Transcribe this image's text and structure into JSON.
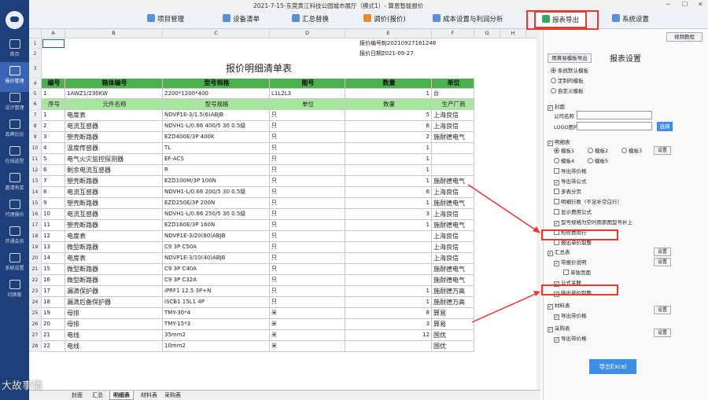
{
  "window": {
    "title": "2021-7-15-东莞黄江科技公园城市展厅（模式1）- 算恩智能报价"
  },
  "sidebar": {
    "items": [
      {
        "label": "首页"
      },
      {
        "label": "报价管理"
      },
      {
        "label": "设计管理"
      },
      {
        "label": "品牌比价"
      },
      {
        "label": "在线选型"
      },
      {
        "label": "邀请有奖"
      },
      {
        "label": "代理报价"
      },
      {
        "label": "开通会员"
      },
      {
        "label": "系统设置"
      },
      {
        "label": "切换版"
      }
    ]
  },
  "toolbar": {
    "items": [
      {
        "label": "项目管理",
        "color": "#5b8fd9"
      },
      {
        "label": "设备清单",
        "color": "#5b8fd9"
      },
      {
        "label": "汇总替换",
        "color": "#5b8fd9"
      },
      {
        "label": "调价(报价)",
        "color": "#e58a2b"
      },
      {
        "label": "成本设置与利润分析",
        "color": "#5b8fd9"
      },
      {
        "label": "报表导出",
        "color": "#3aa564"
      },
      {
        "label": "系统设置",
        "color": "#5b8fd9"
      }
    ]
  },
  "sheet": {
    "columns": [
      "A",
      "B",
      "C",
      "D",
      "E",
      "F",
      "G",
      "H",
      "I"
    ],
    "row_numbers": [
      "1",
      "2",
      "3",
      "4",
      "5",
      "6",
      "7",
      "8",
      "9",
      "10",
      "11",
      "12",
      "13",
      "14",
      "15",
      "16",
      "17",
      "18",
      "19",
      "20",
      "21",
      "22",
      "23",
      "24",
      "25",
      "26",
      "27",
      "28"
    ],
    "quote_no_label": "报价编号：",
    "quote_no": "BJ20210927161248",
    "quote_date_label": "报价日期：",
    "quote_date": "2021-09-27",
    "title": "报价明细清单表",
    "box_header": [
      "编号",
      "箱体编号",
      "型号规格",
      "图号",
      "数量",
      "单位"
    ],
    "box_row": [
      "1",
      "1AWZ1/230KW",
      "2200*1200*400",
      "L1L2L3",
      "1",
      "台"
    ],
    "item_header": [
      "序号",
      "元件名称",
      "型号规格",
      "单位",
      "数量",
      "生产厂商"
    ],
    "items": [
      [
        "1",
        "电度表",
        "NDVP1E-3/1.5(6)ABJB",
        "只",
        "5",
        "上海良信"
      ],
      [
        "2",
        "电流互感器",
        "NDVH1-L/0.66 400/5 30 0.5级",
        "只",
        "6",
        "上海良信"
      ],
      [
        "3",
        "塑壳断路器",
        "EZD400E/3P 400K",
        "只",
        "2",
        "施耐德电气"
      ],
      [
        "4",
        "温度传感器",
        "TL",
        "只",
        "1",
        ""
      ],
      [
        "5",
        "电气火灾监控探测器",
        "EF-ACS",
        "只",
        "1",
        ""
      ],
      [
        "6",
        "剩余电流互感器",
        "R",
        "只",
        "1",
        ""
      ],
      [
        "7",
        "塑壳断路器",
        "EZD100M/3P 100N",
        "只",
        "1",
        "施耐德电气"
      ],
      [
        "8",
        "电流互感器",
        "NDVH1-L/0.66 200/5 30 0.5级",
        "只",
        "6",
        "上海良信"
      ],
      [
        "9",
        "塑壳断路器",
        "EZD250E/3P 200N",
        "只",
        "1",
        "施耐德电气"
      ],
      [
        "10",
        "电流互感器",
        "NDVH1-L/0.66 250/5 30 0.5级",
        "只",
        "3",
        "上海良信"
      ],
      [
        "11",
        "塑壳断路器",
        "EZD160E/3P 160N",
        "只",
        "1",
        "施耐德电气"
      ],
      [
        "12",
        "电度表",
        "NDVP1E-3/20(80)ABJB",
        "只",
        "",
        "上海良信"
      ],
      [
        "13",
        "微型断路器",
        "C9 3P C50A",
        "只",
        "",
        "上海良信"
      ],
      [
        "14",
        "电度表",
        "NDVP1E-3/10(40)ABJB",
        "只",
        "",
        "上海良信"
      ],
      [
        "15",
        "微型断路器",
        "C9 3P C40A",
        "只",
        "",
        "施耐德电气"
      ],
      [
        "16",
        "微型断路器",
        "C9 3P C32A",
        "只",
        "",
        "施耐德电气"
      ],
      [
        "17",
        "漏滴保护器",
        "iPRF1 12.5 3P+N",
        "只",
        "1",
        "施耐德万高"
      ],
      [
        "18",
        "漏滴后备保护器",
        "iSCB1 15L1 4P",
        "只",
        "1",
        "施耐德万高"
      ],
      [
        "19",
        "母排",
        "TMY-30*4",
        "米",
        "8",
        "算易"
      ],
      [
        "20",
        "母排",
        "TMY-15*3",
        "米",
        "3",
        "算易"
      ],
      [
        "21",
        "电线",
        "35mm2",
        "米",
        "12",
        "国优"
      ],
      [
        "22",
        "电线",
        "10mm2",
        "米",
        "",
        "国优"
      ]
    ]
  },
  "sheet_tabs": [
    "封面",
    "汇总",
    "明细表",
    "材料表",
    "采购表"
  ],
  "watermark": "大故事情",
  "panel": {
    "tutorial_btn": "视频教程",
    "template_btn": "用算易模板导出",
    "title": "报表设置",
    "template_options": [
      "系统默认模板",
      "定制的模板",
      "自定义模板"
    ],
    "cover_label": "封面",
    "company_label": "公司名称",
    "logo_label": "LOGO图片",
    "select_btn": "选择",
    "detail_label": "明细表",
    "detail_templates": [
      "模板1",
      "模板2",
      "模板3",
      "模板4",
      "模板5"
    ],
    "set_btn": "设置",
    "detail_opts": [
      "导出带价格",
      "导出带公式",
      "多表分页",
      "明细行数（不足补空白行）",
      "显示费用公式",
      "型号规格为空时用原图型号补上",
      "检修费用行",
      "报出单价取整"
    ],
    "summary_label": "汇总表",
    "summary_opts": [
      "带报价说明",
      "单独页面",
      "公式关联",
      "输出单价取整"
    ],
    "material_label": "材料表",
    "material_opts": [
      "导出带价格"
    ],
    "purchase_label": "采购表",
    "purchase_opts": [
      "导出带价格"
    ],
    "export_btn": "导出Excel"
  }
}
